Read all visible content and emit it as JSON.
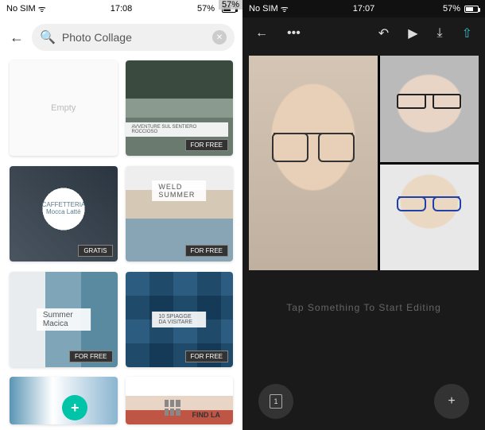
{
  "left": {
    "status": {
      "carrier": "No SIM",
      "time": "17:08",
      "battery_pct": "57%"
    },
    "search": {
      "value": "Photo Collage"
    },
    "cards": [
      {
        "label": "Empty",
        "badge": ""
      },
      {
        "label": "AVVENTURE SUL SENTIERO ROCCIOSO",
        "badge": "FOR FREE"
      },
      {
        "label": "CAFFETTERIA Mocca Latté",
        "badge": "GRATIS"
      },
      {
        "label": "WELD SUMMER",
        "badge": "FOR FREE"
      },
      {
        "label": "Summer Macica",
        "badge": "FOR FREE"
      },
      {
        "label": "10 SPIAGGE DA VISITARE",
        "badge": "FOR FREE"
      },
      {
        "label": "",
        "badge": ""
      },
      {
        "label": "FIND LA",
        "badge": ""
      }
    ]
  },
  "right": {
    "status": {
      "carrier": "No SIM",
      "time": "17:07",
      "battery_pct": "57%"
    },
    "hint": "Tap Something To Start Editing",
    "page_count": "1",
    "plus": "+"
  }
}
